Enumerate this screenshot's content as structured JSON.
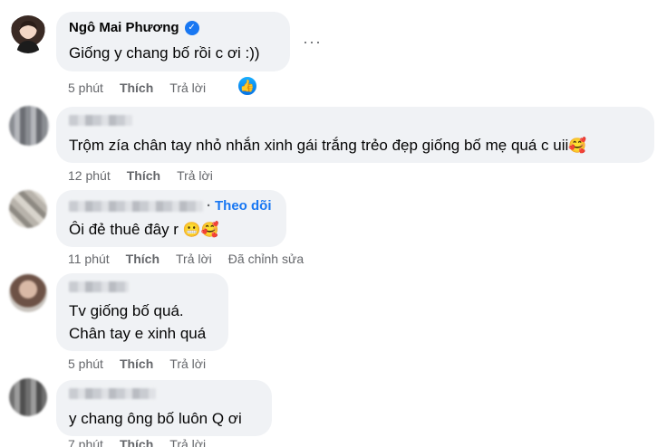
{
  "comments": [
    {
      "author": "Ngô Mai Phương",
      "verified": true,
      "lines": [
        "Giống y chang bố rồi c ơi :))"
      ],
      "time": "5 phút",
      "like": "Thích",
      "reply": "Trả lời",
      "reaction_icon": "thumbs-up-icon",
      "menu_icon": "more-options-icon",
      "menu_glyph": "···"
    },
    {
      "author": "",
      "lines": [
        "Trộm zía chân tay nhỏ nhắn xinh gái trắng trẻo đẹp giống bố mẹ quá c uii"
      ],
      "emoji": "🥰",
      "time": "12 phút",
      "like": "Thích",
      "reply": "Trả lời"
    },
    {
      "author": "",
      "follow": "Theo dõi",
      "separator": "·",
      "lines": [
        "Ôi đẻ thuê đây r"
      ],
      "emoji": "😬🥰",
      "time": "11 phút",
      "like": "Thích",
      "reply": "Trả lời",
      "edited": "Đã chỉnh sửa"
    },
    {
      "author": "",
      "lines": [
        "Tv giống bố quá.",
        "Chân tay e xinh quá"
      ],
      "time": "5 phút",
      "like": "Thích",
      "reply": "Trả lời"
    },
    {
      "author": "",
      "lines": [
        "y chang ông bố luôn Q ơi"
      ],
      "time": "7 phút",
      "like": "Thích",
      "reply": "Trả lời"
    }
  ],
  "colors": {
    "bubble": "#f0f2f5",
    "meta": "#65676b",
    "accent": "#1877f2"
  }
}
